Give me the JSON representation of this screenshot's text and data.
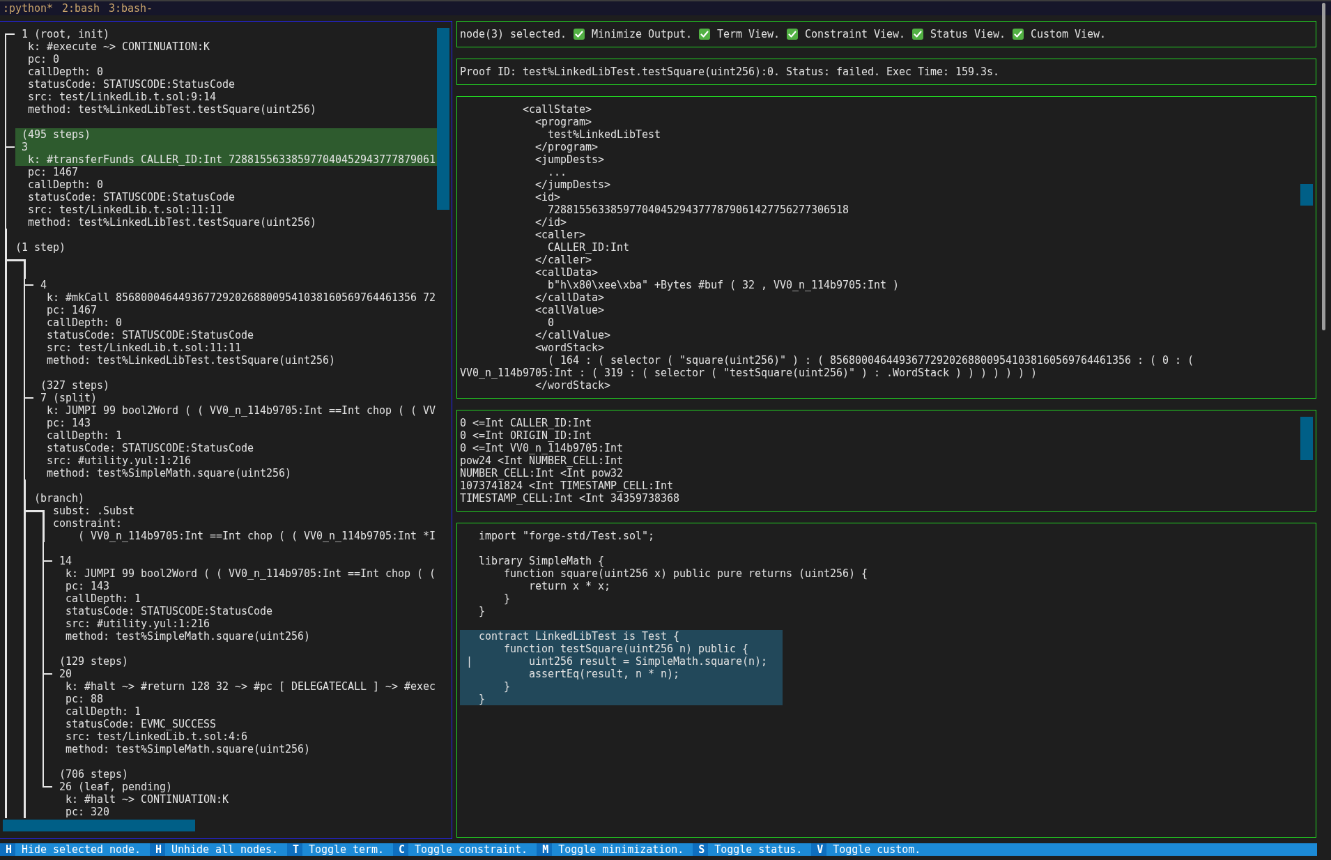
{
  "tmux_bar": {
    "windows": [
      ":python*",
      "2:bash",
      "3:bash-"
    ]
  },
  "tree": [
    {
      "kind": "node",
      "label": "1 (root, init)",
      "selected": false,
      "details": [
        "k: #execute ~> CONTINUATION:K",
        "pc: 0",
        "callDepth: 0",
        "statusCode: STATUSCODE:StatusCode",
        "src: test/LinkedLib.t.sol:9:14",
        "method: test%LinkedLibTest.testSquare(uint256)"
      ]
    },
    {
      "kind": "node",
      "edge": "(495 steps)",
      "label": "3",
      "selected": true,
      "details": [
        "k: #transferFunds CALLER_ID:Int 728815563385977040452943777879061",
        "pc: 1467",
        "callDepth: 0",
        "statusCode: STATUSCODE:StatusCode",
        "src: test/LinkedLib.t.sol:11:11",
        "method: test%LinkedLibTest.testSquare(uint256)"
      ]
    },
    {
      "kind": "fork",
      "edge": "(1 step)",
      "children": [
        {
          "kind": "node",
          "label": "4",
          "selected": false,
          "details": [
            "k: #mkCall 856800046449367729202688009541038160569764461356 72",
            "pc: 1467",
            "callDepth: 0",
            "statusCode: STATUSCODE:StatusCode",
            "src: test/LinkedLib.t.sol:11:11",
            "method: test%LinkedLibTest.testSquare(uint256)"
          ]
        },
        {
          "kind": "node",
          "edge": "(327 steps)",
          "label": "7 (split)",
          "selected": false,
          "details": [
            "k: JUMPI 99 bool2Word ( ( VV0_n_114b9705:Int ==Int chop ( ( VV",
            "pc: 143",
            "callDepth: 1",
            "statusCode: STATUSCODE:StatusCode",
            "src: #utility.yul:1:216",
            "method: test%SimpleMath.square(uint256)"
          ]
        },
        {
          "kind": "branch",
          "label": "(branch)",
          "details": [
            "subst: .Subst",
            "constraint:",
            "    ( VV0_n_114b9705:Int ==Int chop ( ( VV0_n_114b9705:Int *I"
          ],
          "children": [
            {
              "kind": "node",
              "label": "14",
              "selected": false,
              "details": [
                "k: JUMPI 99 bool2Word ( ( VV0_n_114b9705:Int ==Int chop ( (",
                "pc: 143",
                "callDepth: 1",
                "statusCode: STATUSCODE:StatusCode",
                "src: #utility.yul:1:216",
                "method: test%SimpleMath.square(uint256)"
              ]
            },
            {
              "kind": "node",
              "edge": "(129 steps)",
              "label": "20",
              "selected": false,
              "details": [
                "k: #halt ~> #return 128 32 ~> #pc [ DELEGATECALL ] ~> #exec",
                "pc: 88",
                "callDepth: 1",
                "statusCode: EVMC_SUCCESS",
                "src: test/LinkedLib.t.sol:4:6",
                "method: test%SimpleMath.square(uint256)"
              ]
            },
            {
              "kind": "node",
              "edge": "(706 steps)",
              "label": "26 (leaf, pending)",
              "selected": false,
              "details": [
                "k: #halt ~> CONTINUATION:K",
                "pc: 320"
              ]
            }
          ]
        }
      ]
    }
  ],
  "status_panel": {
    "selection": "node(3) selected.",
    "toggles": [
      {
        "label": "Minimize Output.",
        "checked": true
      },
      {
        "label": "Term View.",
        "checked": true
      },
      {
        "label": "Constraint View.",
        "checked": true
      },
      {
        "label": "Status View.",
        "checked": true
      },
      {
        "label": "Custom View.",
        "checked": true
      }
    ]
  },
  "proof_panel": {
    "text": "Proof ID: test%LinkedLibTest.testSquare(uint256):0. Status: failed. Exec Time: 159.3s."
  },
  "term_view": {
    "lines": [
      "          <callState>",
      "            <program>",
      "              test%LinkedLibTest",
      "            </program>",
      "            <jumpDests>",
      "              ...",
      "            </jumpDests>",
      "            <id>",
      "              728815563385977040452943777879061427756277306518",
      "            </id>",
      "            <caller>",
      "              CALLER_ID:Int",
      "            </caller>",
      "            <callData>",
      "              b\"h\\x80\\xee\\xba\" +Bytes #buf ( 32 , VV0_n_114b9705:Int )",
      "            </callData>",
      "            <callValue>",
      "              0",
      "            </callValue>",
      "            <wordStack>",
      "              ( 164 : ( selector ( \"square(uint256)\" ) : ( 856800046449367729202688009541038160569764461356 : ( 0 : (",
      "VV0_n_114b9705:Int : ( 319 : ( selector ( \"testSquare(uint256)\" ) : .WordStack ) ) ) ) ) ) )",
      "            </wordStack>"
    ]
  },
  "constraint_view": {
    "lines": [
      "0 <=Int CALLER_ID:Int",
      "0 <=Int ORIGIN_ID:Int",
      "0 <=Int VV0_n_114b9705:Int",
      "pow24 <Int NUMBER_CELL:Int",
      "NUMBER_CELL:Int <Int pow32",
      "1073741824 <Int TIMESTAMP_CELL:Int",
      "TIMESTAMP_CELL:Int <Int 34359738368"
    ]
  },
  "source_view": {
    "blocks": [
      {
        "highlighted": false,
        "lines": [
          {
            "text": "import \"forge-std/Test.sol\";"
          }
        ]
      },
      {
        "highlighted": false,
        "lines": [
          {
            "text": "library SimpleMath {"
          },
          {
            "text": "    function square(uint256 x) public pure returns (uint256) {"
          },
          {
            "text": "        return x * x;"
          },
          {
            "text": "    }"
          },
          {
            "text": "}"
          }
        ]
      },
      {
        "highlighted": true,
        "lines": [
          {
            "text": "contract LinkedLibTest is Test {"
          },
          {
            "text": "    function testSquare(uint256 n) public {"
          },
          {
            "text": "        uint256 result = SimpleMath.square(n);",
            "marker": "|"
          },
          {
            "text": "        assertEq(result, n * n);"
          },
          {
            "text": "    }"
          },
          {
            "text": "}"
          }
        ]
      }
    ]
  },
  "key_bindings": [
    {
      "key": "H",
      "action": "Hide selected node."
    },
    {
      "key": "H",
      "action": "Unhide all nodes."
    },
    {
      "key": "T",
      "action": "Toggle term."
    },
    {
      "key": "C",
      "action": "Toggle constraint."
    },
    {
      "key": "M",
      "action": "Toggle minimization."
    },
    {
      "key": "S",
      "action": "Toggle status."
    },
    {
      "key": "V",
      "action": "Toggle custom."
    }
  ]
}
